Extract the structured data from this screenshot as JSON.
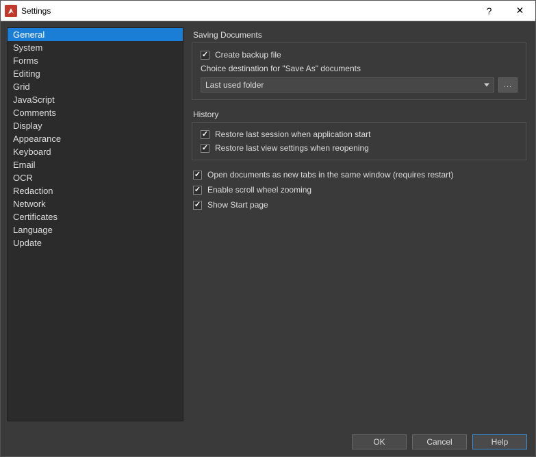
{
  "titlebar": {
    "title": "Settings"
  },
  "sidebar": {
    "items": [
      {
        "label": "General",
        "selected": true
      },
      {
        "label": "System",
        "selected": false
      },
      {
        "label": "Forms",
        "selected": false
      },
      {
        "label": "Editing",
        "selected": false
      },
      {
        "label": "Grid",
        "selected": false
      },
      {
        "label": "JavaScript",
        "selected": false
      },
      {
        "label": "Comments",
        "selected": false
      },
      {
        "label": "Display",
        "selected": false
      },
      {
        "label": "Appearance",
        "selected": false
      },
      {
        "label": "Keyboard",
        "selected": false
      },
      {
        "label": "Email",
        "selected": false
      },
      {
        "label": "OCR",
        "selected": false
      },
      {
        "label": "Redaction",
        "selected": false
      },
      {
        "label": "Network",
        "selected": false
      },
      {
        "label": "Certificates",
        "selected": false
      },
      {
        "label": "Language",
        "selected": false
      },
      {
        "label": "Update",
        "selected": false
      }
    ]
  },
  "main": {
    "saving": {
      "group_label": "Saving Documents",
      "create_backup": {
        "label": "Create backup file",
        "checked": true
      },
      "choice_label": "Choice destination for \"Save As\" documents",
      "dest_select": {
        "value": "Last used folder"
      },
      "browse_label": "..."
    },
    "history": {
      "group_label": "History",
      "restore_session": {
        "label": "Restore last session when application start",
        "checked": true
      },
      "restore_view": {
        "label": "Restore last view settings when reopening",
        "checked": true
      }
    },
    "open_tabs": {
      "label": "Open documents as new tabs in the same window (requires restart)",
      "checked": true
    },
    "scroll_zoom": {
      "label": "Enable scroll wheel zooming",
      "checked": true
    },
    "start_page": {
      "label": "Show Start page",
      "checked": true
    }
  },
  "footer": {
    "ok": "OK",
    "cancel": "Cancel",
    "help": "Help"
  }
}
